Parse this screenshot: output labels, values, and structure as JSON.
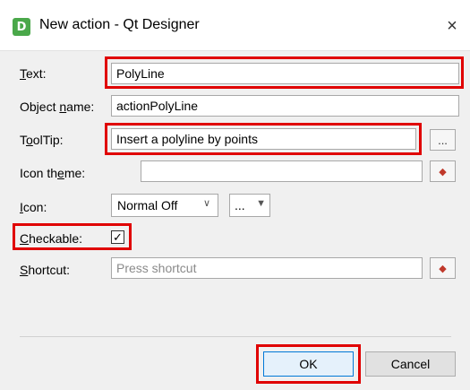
{
  "window": {
    "title": "New action - Qt Designer",
    "app_icon_letter": "D",
    "close_glyph": "×"
  },
  "form": {
    "text": {
      "label": "Text:",
      "value": "PolyLine"
    },
    "object_name": {
      "label": "Object name:",
      "value": "actionPolyLine"
    },
    "tooltip": {
      "label": "ToolTip:",
      "value": "Insert a polyline by points",
      "button_label": "..."
    },
    "icon_theme": {
      "label": "Icon theme:",
      "value": "",
      "reset_icon": "reset-icon"
    },
    "icon": {
      "label": "Icon:",
      "mode_value": "Normal Off",
      "mode_arrow": "∨",
      "file_button_label": "...",
      "file_button_arrow": "▼"
    },
    "checkable": {
      "label": "Checkable:",
      "checked": true,
      "check_glyph": "✓"
    },
    "shortcut": {
      "label": "Shortcut:",
      "placeholder": "Press shortcut",
      "reset_icon": "reset-icon"
    }
  },
  "buttons": {
    "ok_label": "OK",
    "cancel_label": "Cancel"
  },
  "colors": {
    "highlight": "#e00000",
    "window_bg": "#f0f0f0",
    "default_button_border": "#0078d7",
    "app_icon_bg": "#4aa84a"
  }
}
